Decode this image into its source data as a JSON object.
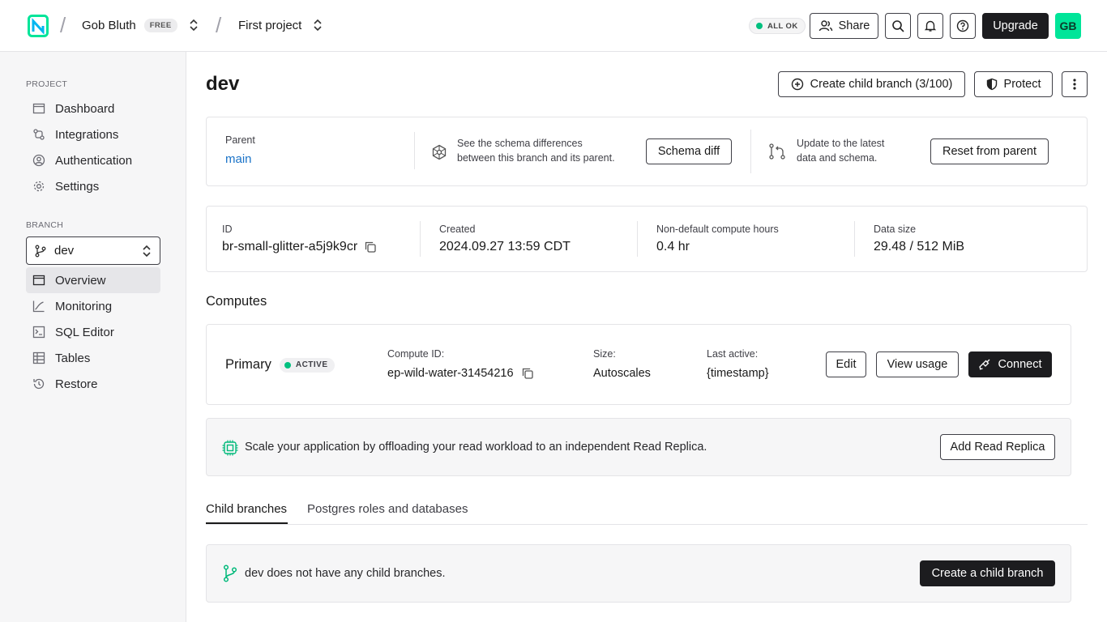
{
  "topbar": {
    "user": "Gob Bluth",
    "plan_badge": "FREE",
    "project": "First project",
    "status": "ALL OK",
    "share_label": "Share",
    "upgrade_label": "Upgrade",
    "avatar_initials": "GB"
  },
  "sidebar": {
    "project_label": "PROJECT",
    "project_items": [
      {
        "label": "Dashboard",
        "icon": "dashboard-icon"
      },
      {
        "label": "Integrations",
        "icon": "integrations-icon"
      },
      {
        "label": "Authentication",
        "icon": "auth-icon"
      },
      {
        "label": "Settings",
        "icon": "gear-icon"
      }
    ],
    "branch_label": "BRANCH",
    "branch_selected": "dev",
    "branch_items": [
      {
        "label": "Overview",
        "icon": "overview-icon",
        "active": true
      },
      {
        "label": "Monitoring",
        "icon": "monitoring-icon"
      },
      {
        "label": "SQL Editor",
        "icon": "sql-editor-icon"
      },
      {
        "label": "Tables",
        "icon": "tables-icon"
      },
      {
        "label": "Restore",
        "icon": "restore-icon"
      }
    ]
  },
  "main": {
    "title": "dev",
    "create_child_label": "Create child branch (3/100)",
    "protect_label": "Protect",
    "parent": {
      "label": "Parent",
      "value": "main",
      "schema_desc_1": "See the schema differences",
      "schema_desc_2": "between this branch and its parent.",
      "schema_diff_label": "Schema diff",
      "reset_desc_1": "Update to the latest",
      "reset_desc_2": "data and schema.",
      "reset_label": "Reset from parent"
    },
    "info": {
      "id_label": "ID",
      "id_value": "br-small-glitter-a5j9k9cr",
      "created_label": "Created",
      "created_value": "2024.09.27 13:59 CDT",
      "hours_label": "Non-default compute hours",
      "hours_value": "0.4 hr",
      "size_label": "Data size",
      "size_value": "29.48 / 512 MiB"
    },
    "computes_heading": "Computes",
    "compute": {
      "name": "Primary",
      "status": "ACTIVE",
      "id_label": "Compute ID:",
      "id_value": "ep-wild-water-31454216",
      "size_label": "Size:",
      "size_value": "Autoscales",
      "last_label": "Last active:",
      "last_value": "{timestamp}",
      "edit_label": "Edit",
      "usage_label": "View usage",
      "connect_label": "Connect"
    },
    "replica": {
      "text": "Scale your application by offloading your read workload to an independent Read Replica.",
      "button": "Add Read Replica"
    },
    "tabs": [
      {
        "label": "Child branches",
        "active": true
      },
      {
        "label": "Postgres roles and databases",
        "active": false
      }
    ],
    "child": {
      "text": "dev does not have any child branches.",
      "button": "Create a child branch"
    }
  },
  "colors": {
    "accent": "#00e599",
    "status_green": "#00c07f",
    "link": "#1a73c8",
    "dark_button": "#1c1c1f"
  }
}
